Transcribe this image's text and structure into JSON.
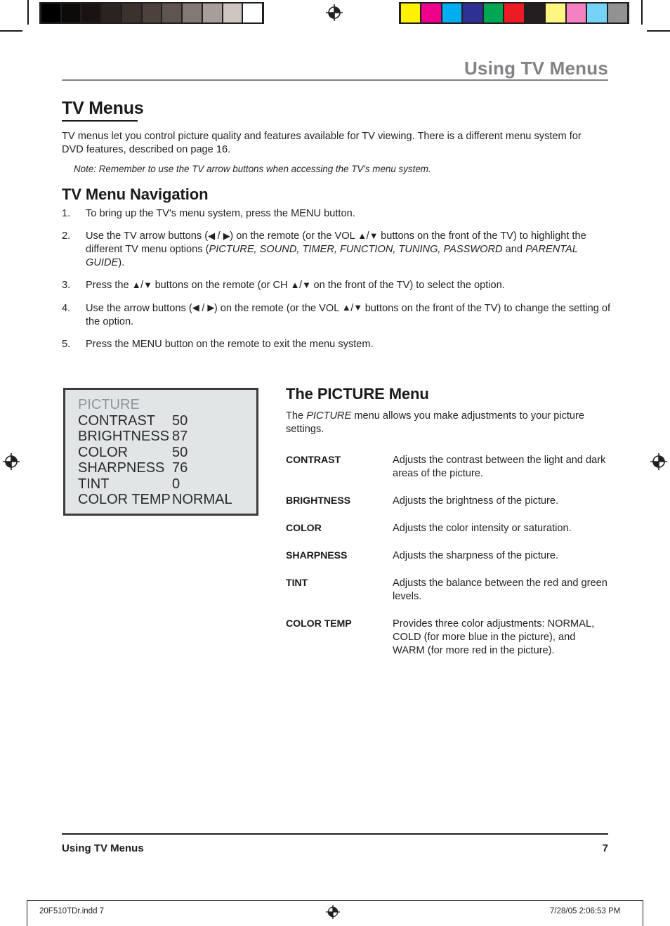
{
  "running_head": "Using TV Menus",
  "headings": {
    "h1": "TV Menus",
    "navigation": "TV Menu Navigation",
    "picture_menu": "The PICTURE Menu"
  },
  "intro": {
    "paragraph": "TV menus let you control picture quality and features available for TV viewing. There is a different menu system for DVD features, described on page 16.",
    "note": "Note: Remember to use the TV arrow buttons when accessing the TV's menu system."
  },
  "steps": [
    {
      "num": "1.",
      "text": "To bring up the TV's menu system, press the MENU button."
    },
    {
      "num": "2.",
      "text": "Use the TV arrow buttons (◀ / ▶) on the remote (or the VOL ▲/▼ buttons on the front of the TV) to highlight the different TV menu options (PICTURE, SOUND, TIMER, FUNCTION, TUNING, PASSWORD and PARENTAL GUIDE)."
    },
    {
      "num": "3.",
      "text": "Press the ▲/▼ buttons on the remote (or CH ▲/▼ on the front of the TV) to select the option."
    },
    {
      "num": "4.",
      "text": "Use the arrow buttons (◀ / ▶) on the remote (or the VOL ▲/▼ buttons on the front of the TV) to change the setting of the option."
    },
    {
      "num": "5.",
      "text": "Press the MENU button on the remote to exit the menu system."
    }
  ],
  "picture_menu_screenshot": {
    "title": "PICTURE",
    "rows": [
      {
        "label": "CONTRAST",
        "value": "50"
      },
      {
        "label": "BRIGHTNESS",
        "value": "87"
      },
      {
        "label": "COLOR",
        "value": "50"
      },
      {
        "label": "SHARPNESS",
        "value": "76"
      },
      {
        "label": "TINT",
        "value": "0"
      },
      {
        "label": "COLOR TEMP",
        "value": "NORMAL"
      }
    ],
    "background_color": "#e2e5e6",
    "border_color": "#3b3b3b",
    "title_color": "#8d979c"
  },
  "picture_menu_intro": "The PICTURE menu allows you make adjustments to your picture settings.",
  "definitions": [
    {
      "term": "CONTRAST",
      "desc": "Adjusts the contrast between the light and dark areas of the picture."
    },
    {
      "term": "BRIGHTNESS",
      "desc": "Adjusts the brightness of the picture."
    },
    {
      "term": "COLOR",
      "desc": "Adjusts the color intensity or saturation."
    },
    {
      "term": "SHARPNESS",
      "desc": "Adjusts the sharpness of the picture."
    },
    {
      "term": "TINT",
      "desc": "Adjusts the balance between the red and green levels."
    },
    {
      "term": "COLOR TEMP",
      "desc": "Provides three color adjustments: NORMAL, COLD (for more blue in the picture), and WARM (for more red in the picture)."
    }
  ],
  "footer": {
    "left": "Using TV Menus",
    "page_number": "7"
  },
  "print_slug": {
    "file": "20F510TDr.indd   7",
    "date_time": "7/28/05   2:06:53 PM"
  },
  "calibration": {
    "grayscale_swatches": [
      "#000000",
      "#0d0a0a",
      "#191412",
      "#2a2320",
      "#3b322e",
      "#4c413c",
      "#5f5450",
      "#837873",
      "#a89d99",
      "#cfc6c2",
      "#ffffff"
    ],
    "color_swatches": [
      "#fff200",
      "#ec008c",
      "#00aeef",
      "#2e3192",
      "#00a651",
      "#ed1c24",
      "#231f20",
      "#fff580",
      "#f582c0",
      "#76d3f7",
      "#929292"
    ]
  },
  "icons": {
    "registration_target": "registration-target-icon",
    "left_arrow": "◀",
    "right_arrow": "▶",
    "up_arrow": "▲",
    "down_arrow": "▼"
  }
}
